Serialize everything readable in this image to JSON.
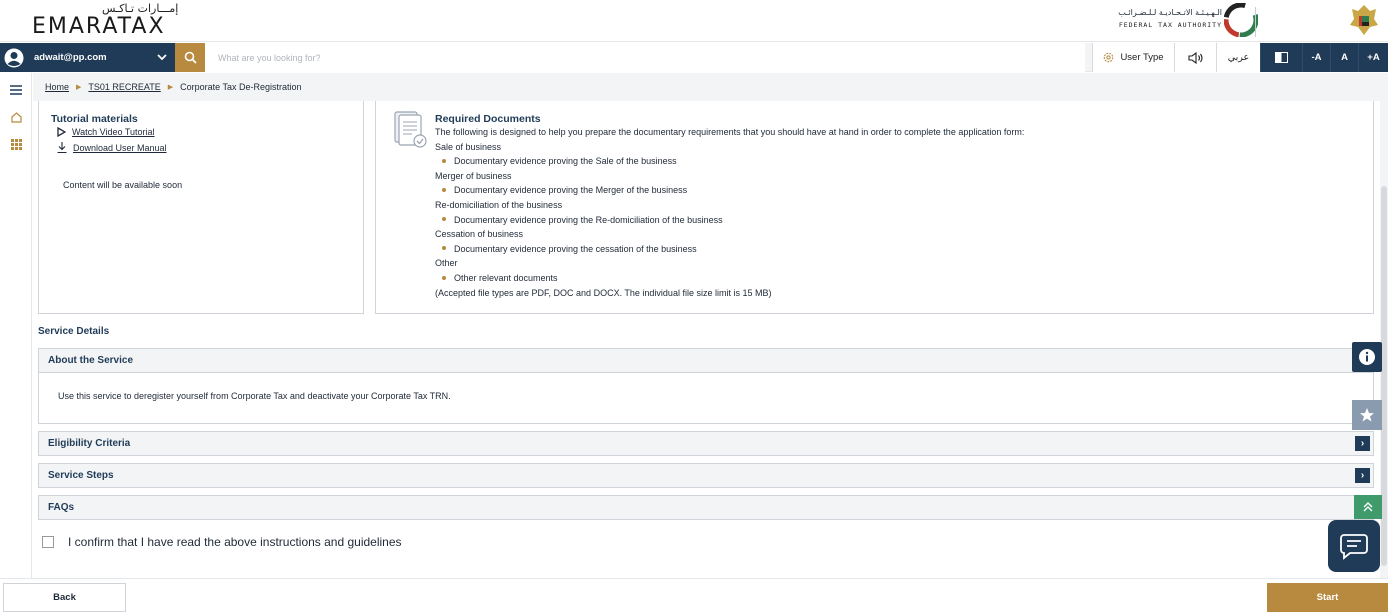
{
  "header": {
    "logo_ar": "إمـــارات تـاكـس",
    "logo_en": "EMARATAX",
    "authority_ar": "الـهـيـئـة الاتـحـاديـة لـلـضـرائـب",
    "authority_en": "FEDERAL TAX AUTHORITY"
  },
  "navbar": {
    "user": "adwait@pp.com",
    "search_placeholder": "What are you looking for?",
    "user_type": "User Type",
    "arabic": "عربي",
    "font_decrease": "-A",
    "font_normal": "A",
    "font_increase": "+A"
  },
  "breadcrumb": {
    "home": "Home",
    "parent": "TS01 RECREATE",
    "current": "Corporate Tax De-Registration"
  },
  "tutorial": {
    "title": "Tutorial materials",
    "video": "Watch Video Tutorial",
    "manual": "Download User Manual",
    "note": "Content will be available soon"
  },
  "required": {
    "title": "Required Documents",
    "intro": "The following is designed to help you prepare the documentary requirements that you should have at hand in order to complete the application form:",
    "groups": [
      {
        "heading": "Sale of business",
        "item": "Documentary evidence proving the Sale of the business"
      },
      {
        "heading": "Merger of business",
        "item": "Documentary evidence proving the Merger of the business"
      },
      {
        "heading": "Re-domiciliation of the business",
        "item": "Documentary evidence proving the Re-domiciliation of the business"
      },
      {
        "heading": "Cessation of business",
        "item": "Documentary evidence proving the cessation of the business"
      },
      {
        "heading": "Other",
        "item": "Other relevant documents"
      }
    ],
    "footnote": "(Accepted file types are PDF, DOC and DOCX. The individual file size limit is 15 MB)"
  },
  "service": {
    "title": "Service Details",
    "sections": [
      {
        "label": "About the Service",
        "body": "Use this service to deregister yourself from Corporate Tax and deactivate your Corporate Tax TRN."
      },
      {
        "label": "Eligibility Criteria"
      },
      {
        "label": "Service Steps"
      },
      {
        "label": "FAQs"
      }
    ]
  },
  "confirm_label": "I confirm that I have read the above instructions and guidelines",
  "footer": {
    "back": "Back",
    "start": "Start"
  },
  "colors": {
    "navy": "#1f3b57",
    "gold": "#b78a3f",
    "green": "#3f9b6b"
  }
}
